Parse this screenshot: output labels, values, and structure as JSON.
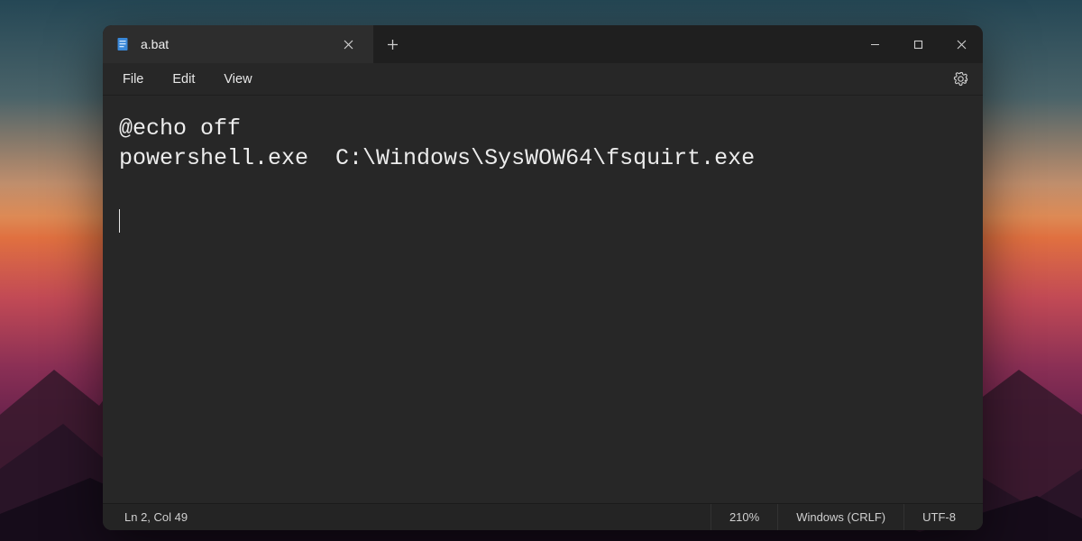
{
  "tab": {
    "title": "a.bat"
  },
  "menu": {
    "file": "File",
    "edit": "Edit",
    "view": "View"
  },
  "editor": {
    "lines": [
      "@echo off",
      "powershell.exe  C:\\Windows\\SysWOW64\\fsquirt.exe"
    ]
  },
  "status": {
    "position": "Ln 2, Col 49",
    "zoom": "210%",
    "lineending": "Windows (CRLF)",
    "encoding": "UTF-8"
  }
}
